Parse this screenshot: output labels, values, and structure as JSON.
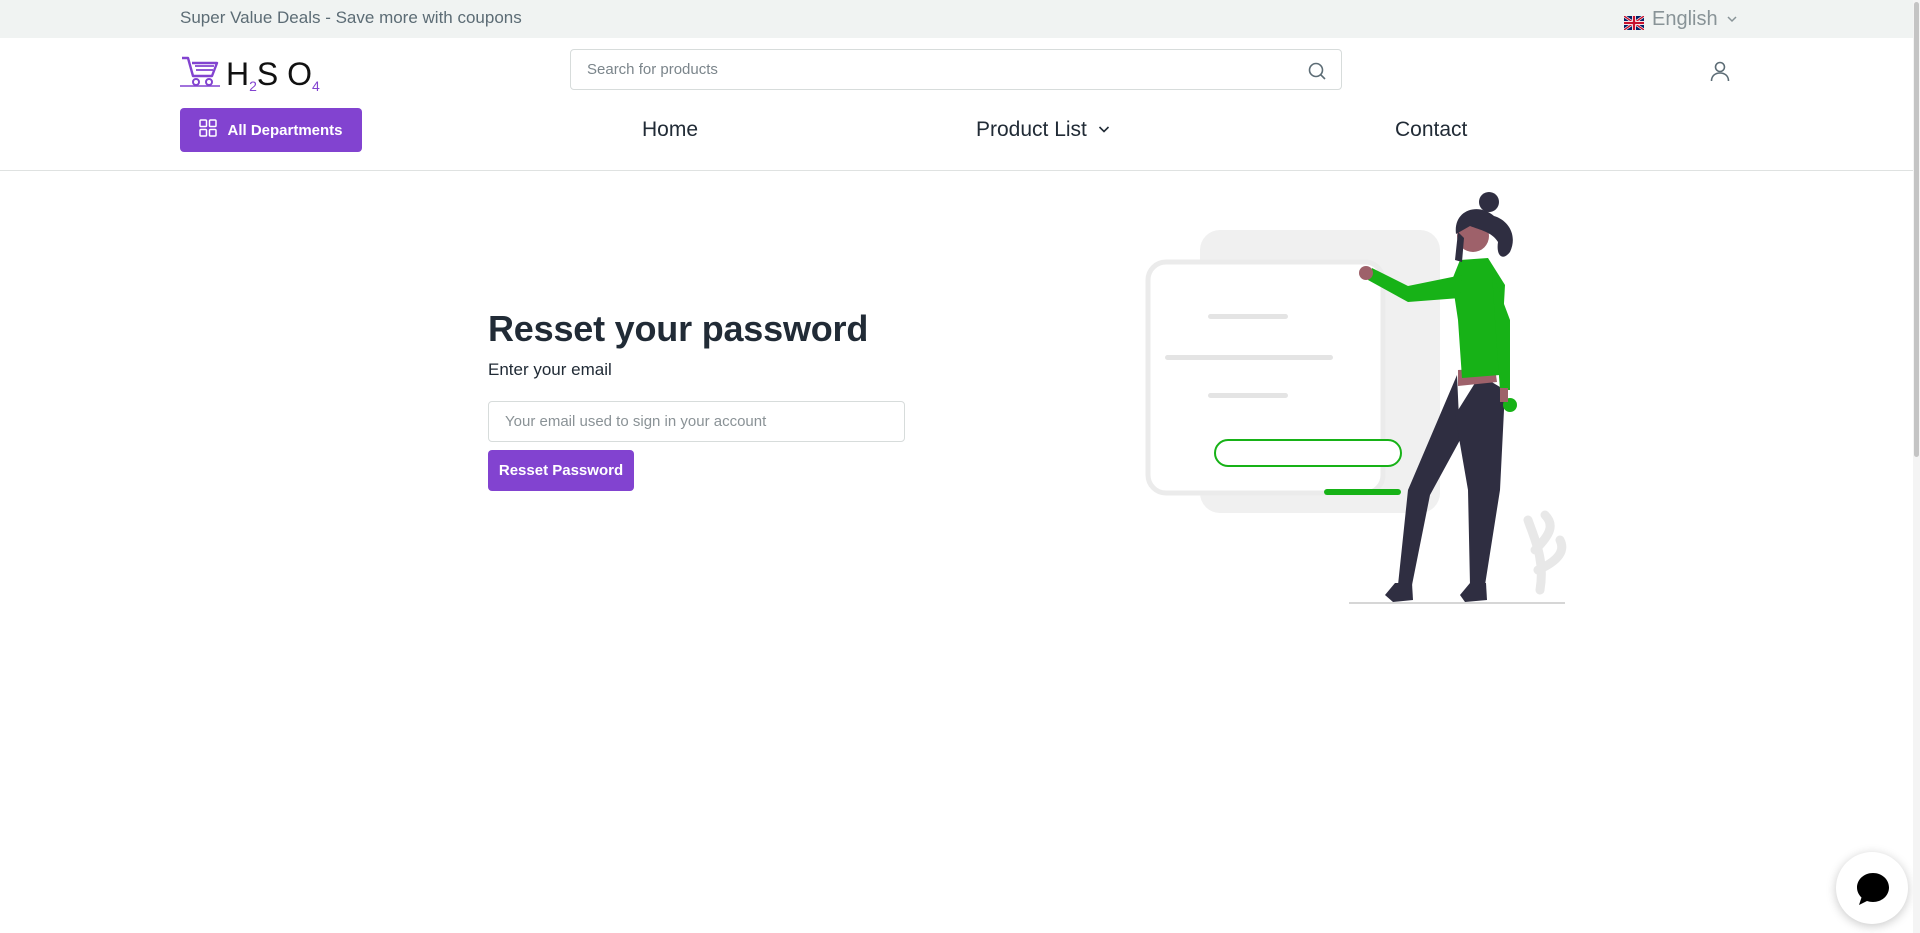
{
  "topbar": {
    "promo": "Super Value Deals - Save more with coupons",
    "language": "English",
    "language_icon": "uk-flag-icon"
  },
  "header": {
    "logo": {
      "main": "H",
      "sub1": "2",
      "mid": "S O",
      "sub2": "4",
      "icon": "shopping-cart-icon"
    },
    "search": {
      "placeholder": "Search for products",
      "value": "",
      "icon": "search-icon"
    },
    "user_icon": "user-icon"
  },
  "nav": {
    "departments_label": "All Departments",
    "departments_icon": "grid-icon",
    "items": [
      {
        "label": "Home"
      },
      {
        "label": "Product List",
        "has_dropdown": true
      },
      {
        "label": "Contact"
      }
    ]
  },
  "reset_form": {
    "title": "Resset your password",
    "subtitle": "Enter your email",
    "email_placeholder": "Your email used to sign in your account",
    "email_value": "",
    "button_label": "Resset Password"
  },
  "colors": {
    "brand": "#8243d0",
    "illustration_accent": "#17b217",
    "topbar_bg": "#f0f3f2"
  },
  "chat_widget": {
    "icon": "chat-bubble-icon"
  }
}
